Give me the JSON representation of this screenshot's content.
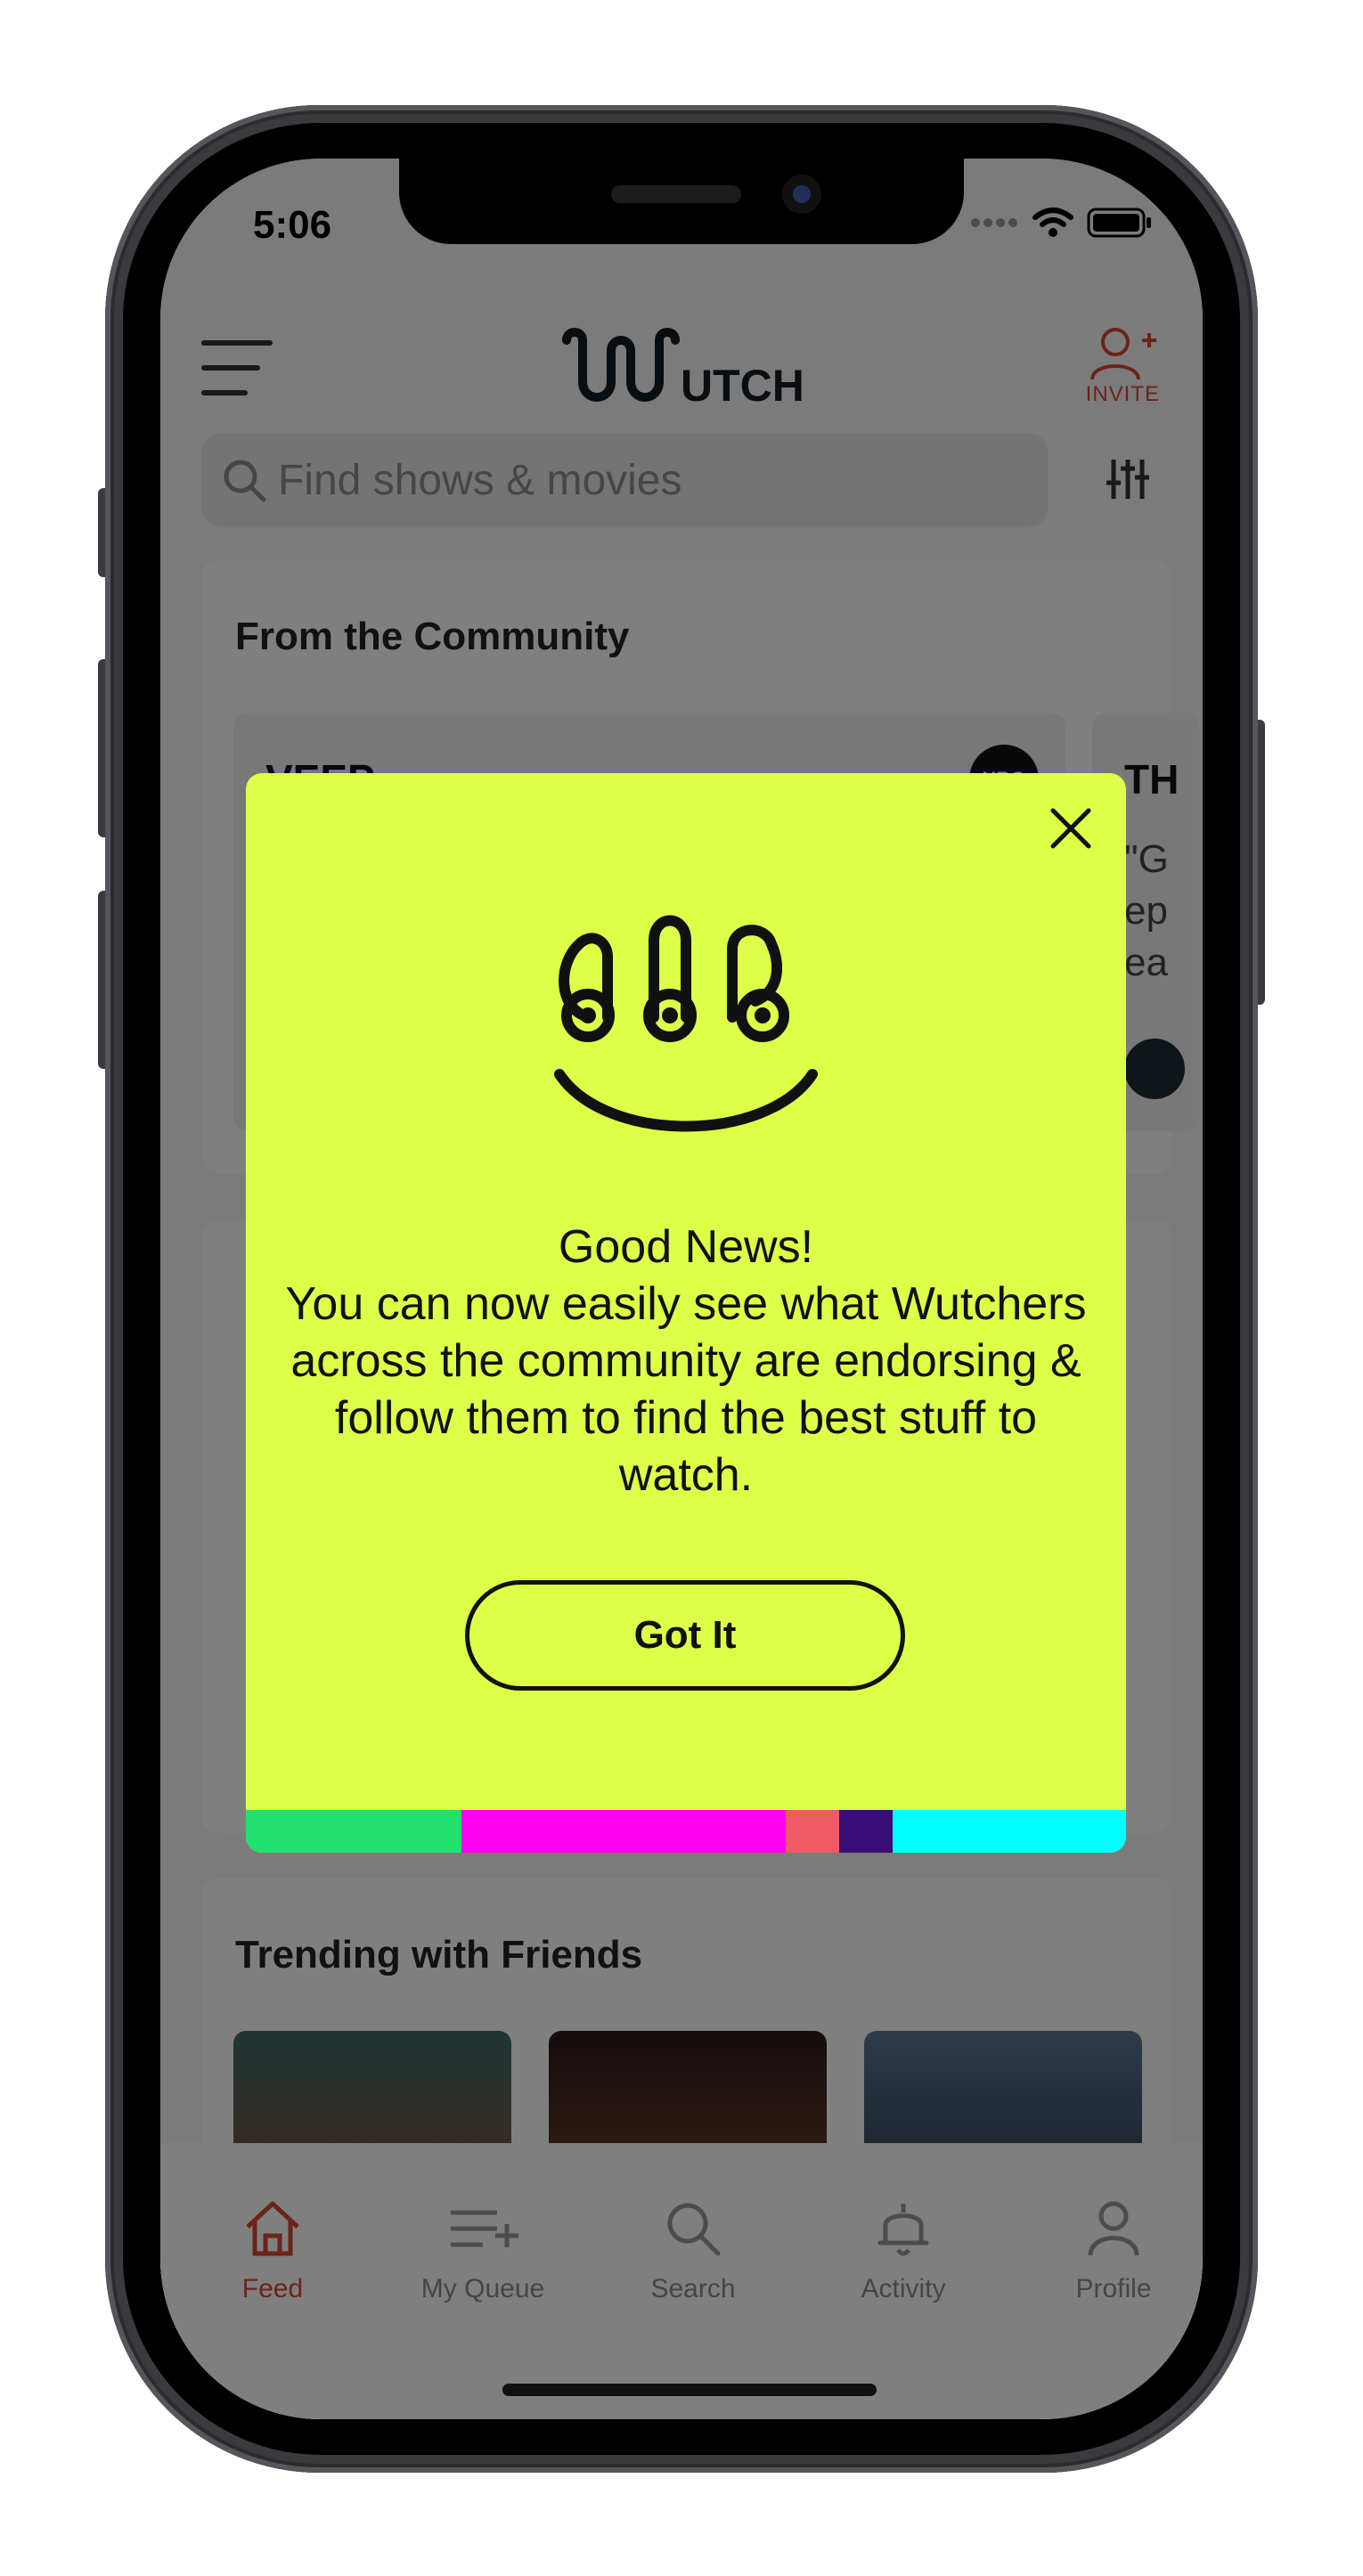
{
  "status_bar": {
    "time": "5:06"
  },
  "header": {
    "logo_text": "Wutch",
    "invite_label": "INVITE"
  },
  "search": {
    "placeholder": "Find shows & movies"
  },
  "community": {
    "title": "From the Community",
    "card1_title": "VEEP",
    "card2_title": "TH",
    "card2_snippet": "\"G\nep\nea"
  },
  "trending": {
    "title": "Trending with Friends"
  },
  "tab_bar": {
    "items": [
      {
        "label": "Feed",
        "icon": "home-icon",
        "active": true
      },
      {
        "label": "My Queue",
        "icon": "queue-add-icon",
        "active": false
      },
      {
        "label": "Search",
        "icon": "search-icon",
        "active": false
      },
      {
        "label": "Activity",
        "icon": "bell-icon",
        "active": false
      },
      {
        "label": "Profile",
        "icon": "person-icon",
        "active": false
      }
    ]
  },
  "modal": {
    "headline": "Good News!",
    "body": "You can now easily see what Wutchers across the community are endorsing & follow them to find the best stuff to watch.",
    "button_label": "Got It",
    "background_color": "#deff48",
    "strip_colors": [
      "#22e06e",
      "#ff00f0",
      "#f05a64",
      "#3a0e78",
      "#00ffff"
    ]
  },
  "colors": {
    "accent": "#d74634",
    "overlay": "rgba(0,0,0,0.5)"
  }
}
